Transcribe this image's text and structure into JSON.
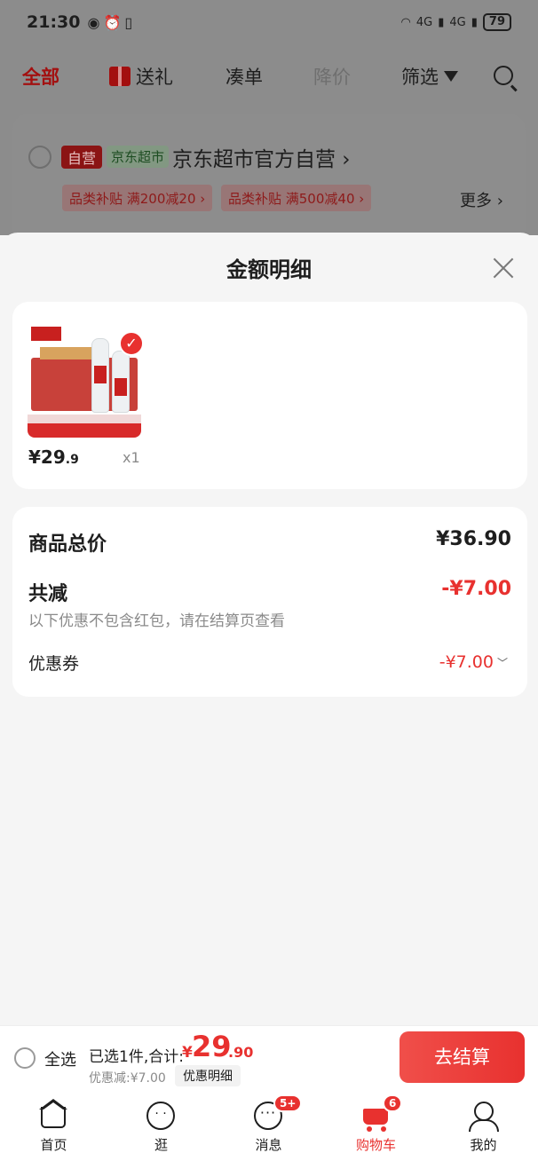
{
  "status_bar": {
    "time": "21:30",
    "battery": "79",
    "signal_1": "4G",
    "signal_2": "4G"
  },
  "filter_tabs": [
    {
      "label": "全部"
    },
    {
      "label": "送礼"
    },
    {
      "label": "凑单"
    },
    {
      "label": "降价"
    },
    {
      "label": "筛选"
    }
  ],
  "store": {
    "badge_self": "自营",
    "badge_mart": "京东超市",
    "name": "京东超市官方自营",
    "promos": [
      "品类补贴 满200减20",
      "品类补贴 满500减40"
    ],
    "more": "更多"
  },
  "sheet": {
    "title": "金额明细",
    "product": {
      "price_int": "¥29",
      "price_dec": ".9",
      "qty": "x1"
    },
    "summary": {
      "total_label": "商品总价",
      "total_value": "¥36.90",
      "discount_label": "共减",
      "discount_value": "-¥7.00",
      "note": "以下优惠不包含红包，请在结算页查看",
      "coupon_label": "优惠券",
      "coupon_value": "-¥7.00"
    }
  },
  "checkout": {
    "select_all": "全选",
    "selected_text": "已选1件,合计:",
    "currency": "¥",
    "total_int": "29",
    "total_dec": ".90",
    "discount_text": "优惠减:¥7.00",
    "detail_button": "优惠明细",
    "checkout_button": "去结算"
  },
  "nav": [
    {
      "label": "首页"
    },
    {
      "label": "逛"
    },
    {
      "label": "消息",
      "badge": "5+"
    },
    {
      "label": "购物车",
      "badge": "6"
    },
    {
      "label": "我的"
    }
  ],
  "colors": {
    "accent": "#e8312f",
    "text": "#1e1e1e",
    "muted": "#8a8a8a"
  }
}
